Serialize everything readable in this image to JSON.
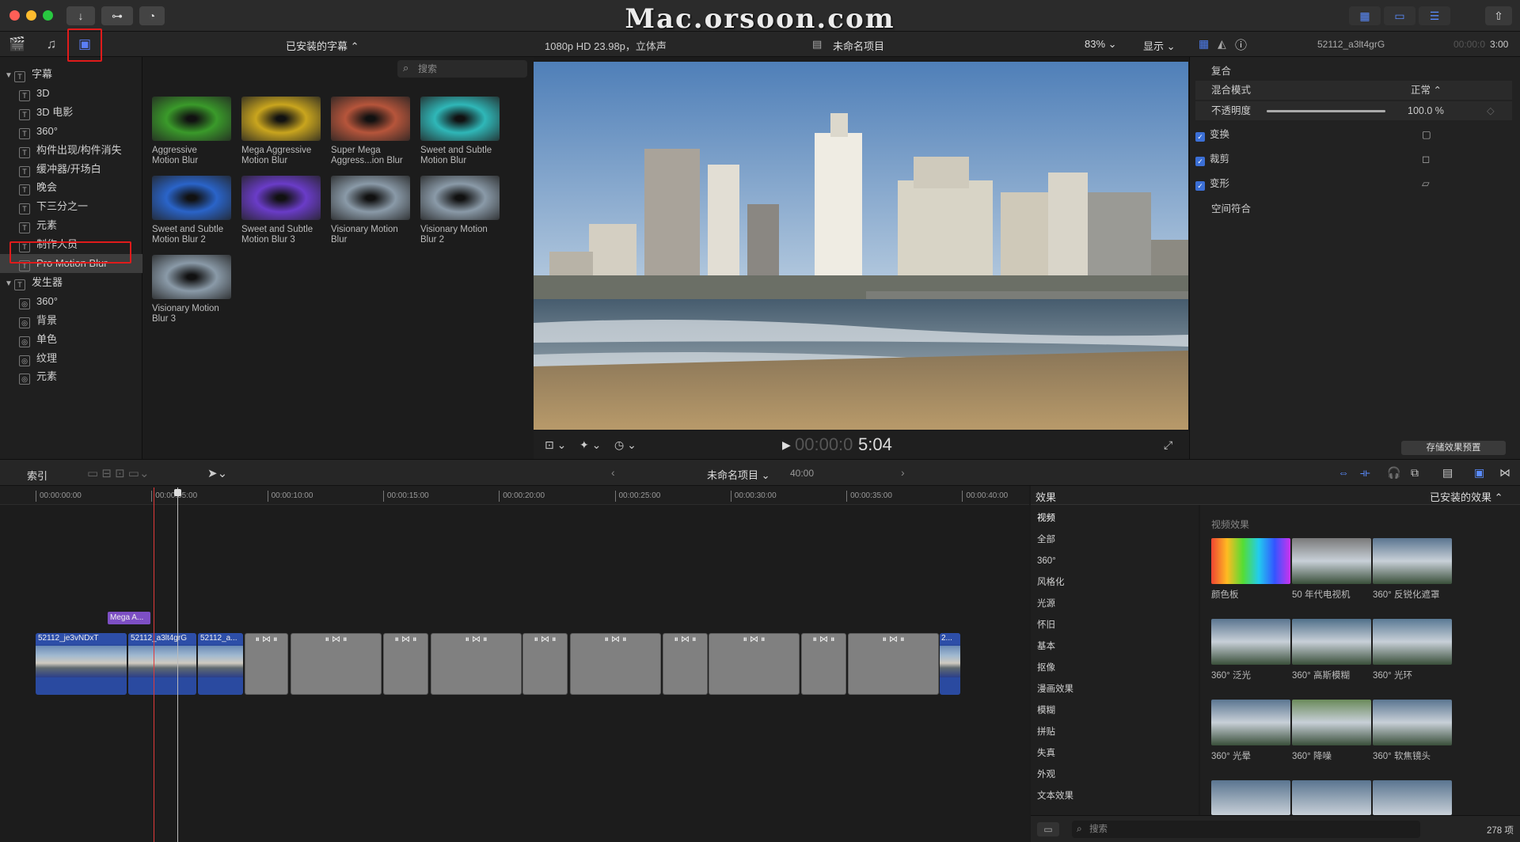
{
  "window": {
    "watermark": "Mac.orsoon.com",
    "title_buttons": [
      "↓",
      "⊶",
      "◔"
    ],
    "right_buttons": [
      "▦",
      "▭",
      "☰"
    ],
    "share_icon": "⇧"
  },
  "library": {
    "tab_icons": [
      "clapper-icon",
      "photos-music-icon",
      "titles-generators-icon"
    ],
    "items": [
      {
        "label": "字幕",
        "group": true
      },
      {
        "label": "3D"
      },
      {
        "label": "3D 电影"
      },
      {
        "label": "360°"
      },
      {
        "label": "构件出现/构件消失"
      },
      {
        "label": "缓冲器/开场白"
      },
      {
        "label": "晚会"
      },
      {
        "label": "下三分之一"
      },
      {
        "label": "元素"
      },
      {
        "label": "制作人员"
      },
      {
        "label": "Pro Motion Blur",
        "selected": true
      },
      {
        "label": "发生器",
        "group": true
      },
      {
        "label": "360°"
      },
      {
        "label": "背景"
      },
      {
        "label": "单色"
      },
      {
        "label": "纹理"
      },
      {
        "label": "元素"
      }
    ]
  },
  "browser": {
    "header": "已安装的字幕 ⌃",
    "search_placeholder": "搜索",
    "items": [
      {
        "line1": "Aggressive",
        "line2": "Motion Blur",
        "color": "#3a9a2a"
      },
      {
        "line1": "Mega Aggressive",
        "line2": "Motion Blur",
        "color": "#c9a51e"
      },
      {
        "line1": "Super Mega",
        "line2": "Aggress...ion Blur",
        "color": "#b6553b"
      },
      {
        "line1": "Sweet and Subtle",
        "line2": "Motion Blur",
        "color": "#2fb7b8"
      },
      {
        "line1": "Sweet and Subtle",
        "line2": "Motion Blur 2",
        "color": "#2a64c9"
      },
      {
        "line1": "Sweet and Subtle",
        "line2": "Motion Blur 3",
        "color": "#6a3cc8"
      },
      {
        "line1": "Visionary Motion",
        "line2": "Blur",
        "color": "#8a9aa8"
      },
      {
        "line1": "Visionary Motion",
        "line2": "Blur 2",
        "color": "#8a9aa8"
      },
      {
        "line1": "Visionary Motion",
        "line2": "Blur 3",
        "color": "#8a9aa8"
      }
    ]
  },
  "viewer": {
    "format": "1080p HD 23.98p，立体声",
    "project": "未命名项目",
    "zoom": "83% ⌄",
    "display": "显示 ⌄",
    "timecode_dim": "00:00:0",
    "timecode_bright": "5:04"
  },
  "inspector": {
    "clip_name": "52112_a3lt4grG",
    "duration_dim": "00:00:0",
    "duration_bright": "3:00",
    "section": "复合",
    "blend_label": "混合模式",
    "blend_value": "正常 ⌃",
    "opacity_label": "不透明度",
    "opacity_value": "100.0 %",
    "opacity_level": 1.0,
    "checks": [
      "变换",
      "裁剪",
      "变形"
    ],
    "spatial": "空间符合",
    "save_preset": "存储效果预置"
  },
  "timeline": {
    "index": "索引",
    "project": "未命名项目 ⌄",
    "duration": "40:00",
    "ticks": [
      "00:00:00:00",
      "00:00:05:00",
      "00:00:10:00",
      "00:00:15:00",
      "00:00:20:00",
      "00:00:25:00",
      "00:00:30:00",
      "00:00:35:00",
      "00:00:40:00"
    ],
    "title_clip": "Mega A...",
    "clips": [
      "52112_je3vNDxT",
      "52112_a3lt4grG",
      "52112_a...",
      "2..."
    ]
  },
  "effects": {
    "header": "效果",
    "installed": "已安装的效果 ⌃",
    "categories": [
      "视频",
      "全部",
      "360°",
      "风格化",
      "光源",
      "怀旧",
      "基本",
      "抠像",
      "漫画效果",
      "模糊",
      "拼贴",
      "失真",
      "外观",
      "文本效果"
    ],
    "group_title": "视频效果",
    "items": [
      {
        "label": "颜色板",
        "color": "rainbow"
      },
      {
        "label": "50 年代电视机",
        "color": "#7a7a7a"
      },
      {
        "label": "360° 反锐化遮罩",
        "color": "#5a7590"
      },
      {
        "label": "360° 泛光",
        "color": "#5a7590"
      },
      {
        "label": "360° 高斯模糊",
        "color": "#50708a"
      },
      {
        "label": "360° 光环",
        "color": "#5a7a95"
      },
      {
        "label": "360° 光晕",
        "color": "#5a7590"
      },
      {
        "label": "360° 降噪",
        "color": "#6a8a5a"
      },
      {
        "label": "360° 软焦镜头",
        "color": "#5a7590"
      }
    ],
    "search_placeholder": "搜索",
    "count": "278 项"
  }
}
